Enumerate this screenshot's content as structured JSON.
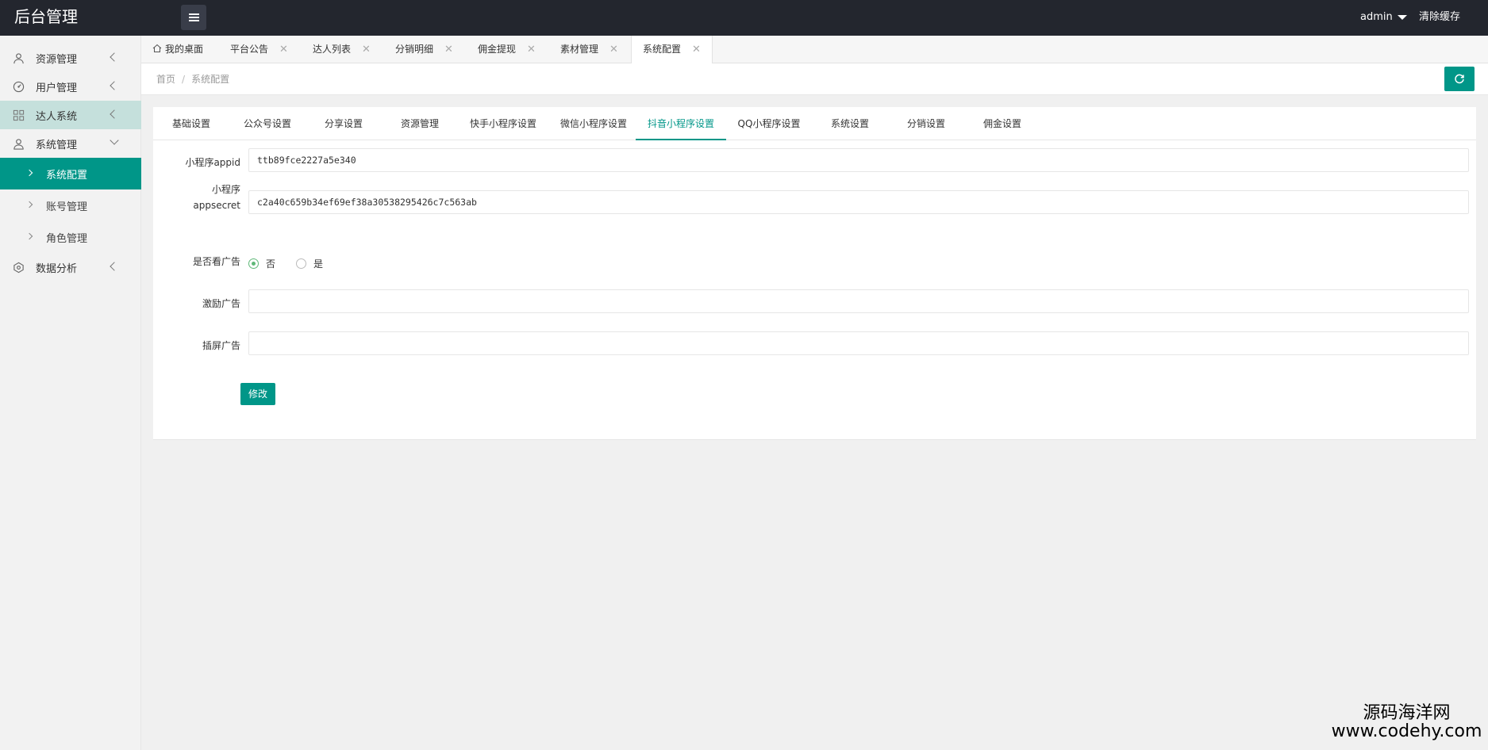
{
  "header": {
    "title": "后台管理",
    "user": "admin",
    "clear_cache": "清除缓存"
  },
  "sidebar": {
    "items": [
      {
        "label": "资源管理"
      },
      {
        "label": "用户管理"
      },
      {
        "label": "达人系统"
      },
      {
        "label": "系统管理"
      },
      {
        "label": "数据分析"
      }
    ],
    "sub_items": [
      {
        "label": "系统配置"
      },
      {
        "label": "账号管理"
      },
      {
        "label": "角色管理"
      }
    ]
  },
  "tabs": {
    "home": "我的桌面",
    "items": [
      {
        "label": "平台公告"
      },
      {
        "label": "达人列表"
      },
      {
        "label": "分销明细"
      },
      {
        "label": "佣金提现"
      },
      {
        "label": "素材管理"
      },
      {
        "label": "系统配置"
      }
    ]
  },
  "breadcrumb": {
    "home": "首页",
    "sep": "/",
    "current": "系统配置"
  },
  "settings_tabs": [
    {
      "label": "基础设置"
    },
    {
      "label": "公众号设置"
    },
    {
      "label": "分享设置"
    },
    {
      "label": "资源管理"
    },
    {
      "label": "快手小程序设置"
    },
    {
      "label": "微信小程序设置"
    },
    {
      "label": "抖音小程序设置"
    },
    {
      "label": "QQ小程序设置"
    },
    {
      "label": "系统设置"
    },
    {
      "label": "分销设置"
    },
    {
      "label": "佣金设置"
    }
  ],
  "form": {
    "appid_label": "小程序appid",
    "appid_value": "ttb89fce2227a5e340",
    "secret_label_1": "小程序",
    "secret_label_2": "appsecret",
    "secret_value": "c2a40c659b34ef69ef38a30538295426c7c563ab",
    "ad_label": "是否看广告",
    "ad_no": "否",
    "ad_yes": "是",
    "reward_label": "激励广告",
    "reward_value": "",
    "interstitial_label": "插屏广告",
    "interstitial_value": "",
    "submit": "修改"
  },
  "watermark": {
    "line1": "源码海洋网",
    "line2": "www.codehy.com"
  },
  "colors": {
    "accent": "#009688",
    "header_bg": "#23262e",
    "radio_on": "#5fb878"
  }
}
